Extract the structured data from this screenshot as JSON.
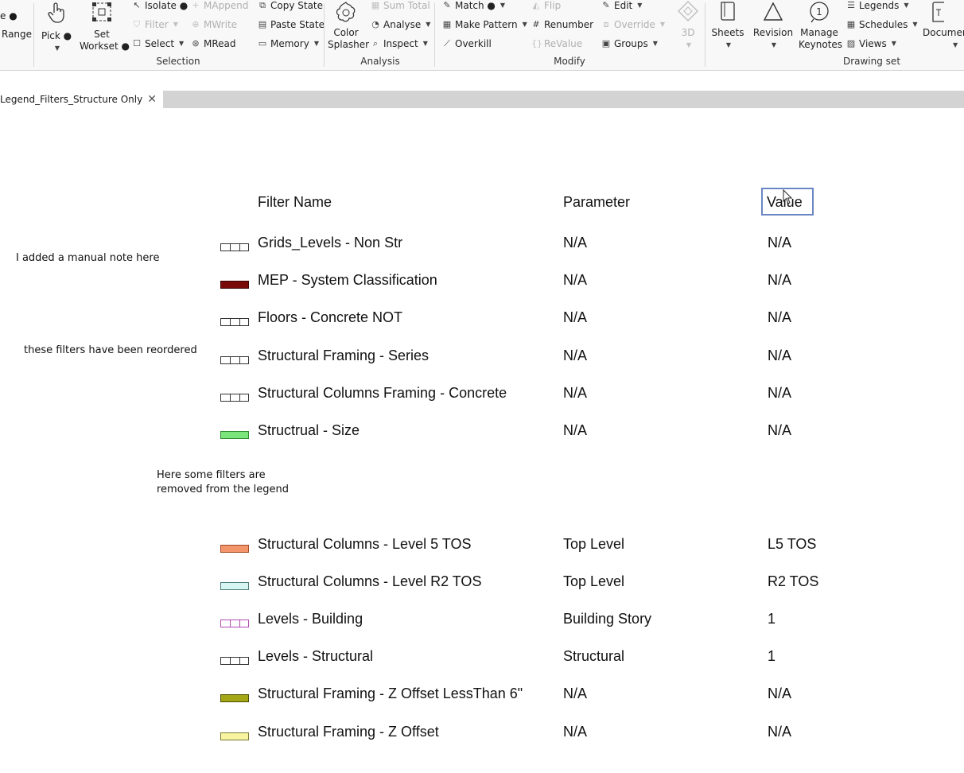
{
  "ribbon": {
    "left_cut": {
      "top": "e ●",
      "range": "Range"
    },
    "pick": {
      "label": "Pick ●"
    },
    "set_workset": {
      "line1": "Set",
      "line2": "Workset ●"
    },
    "selection_col1": {
      "isolate": "Isolate ●",
      "filter": "Filter",
      "select": "Select"
    },
    "selection_col2": {
      "mappend": "MAppend",
      "mwrite": "MWrite",
      "mread": "MRead"
    },
    "selection_col3": {
      "copy_state": "Copy State",
      "paste_state": "Paste State",
      "memory": "Memory"
    },
    "panel_selection": "Selection",
    "color_splasher": {
      "line1": "Color",
      "line2": "Splasher"
    },
    "analysis_col": {
      "sum_total": "Sum Total",
      "analyse": "Analyse",
      "inspect": "Inspect"
    },
    "panel_analysis": "Analysis",
    "modify_col1": {
      "match": "Match ●",
      "make_pattern": "Make Pattern",
      "overkill": "Overkill"
    },
    "modify_col2": {
      "flip": "Flip",
      "renumber": "Renumber",
      "revalue": "ReValue"
    },
    "modify_col3": {
      "edit": "Edit",
      "override": "Override",
      "groups": "Groups"
    },
    "panel_modify": "Modify",
    "threed": "3D",
    "sheets": "Sheets",
    "revision": "Revision",
    "manage_keynotes": {
      "line1": "Manage",
      "line2": "Keynotes"
    },
    "drawing_col": {
      "legends": "Legends",
      "schedules": "Schedules",
      "views": "Views"
    },
    "panel_drawing_set": "Drawing set",
    "documents": "Documen"
  },
  "tab": {
    "title": "Legend_Filters_Structure Only",
    "close": "✕"
  },
  "legend": {
    "headers": {
      "name": "Filter Name",
      "parameter": "Parameter",
      "value": "Value"
    },
    "rows_top": [
      {
        "name": "Grids_Levels - Non Str",
        "parameter": "N/A",
        "value": "N/A",
        "fill": "hatch",
        "border": "#333333"
      },
      {
        "name": "MEP - System Classification",
        "parameter": "N/A",
        "value": "N/A",
        "fill": "#7a0a0a",
        "border": "#3a0000"
      },
      {
        "name": "Floors - Concrete NOT",
        "parameter": "N/A",
        "value": "N/A",
        "fill": "hatch",
        "border": "#333333"
      },
      {
        "name": "Structural Framing - Series",
        "parameter": "N/A",
        "value": "N/A",
        "fill": "hatch",
        "border": "#333333"
      },
      {
        "name": "Structural Columns Framing - Concrete",
        "parameter": "N/A",
        "value": "N/A",
        "fill": "hatch",
        "border": "#333333"
      },
      {
        "name": "Structrual - Size",
        "parameter": "N/A",
        "value": "N/A",
        "fill": "#7be57b",
        "border": "#2f8a2f"
      }
    ],
    "rows_bottom": [
      {
        "name": "Structural Columns - Level 5 TOS",
        "parameter": "Top Level",
        "value": "L5 TOS",
        "fill": "#f4946a",
        "border": "#a04a24"
      },
      {
        "name": "Structural Columns - Level R2 TOS",
        "parameter": "Top Level",
        "value": "R2 TOS",
        "fill": "#d6f5f3",
        "border": "#4a7a78"
      },
      {
        "name": "Levels - Building",
        "parameter": "Building Story",
        "value": "1",
        "fill": "hatch",
        "border": "#b04ab0"
      },
      {
        "name": "Levels - Structural",
        "parameter": "Structural",
        "value": "1",
        "fill": "hatch",
        "border": "#333333"
      },
      {
        "name": "Structural Framing - Z Offset LessThan 6\"",
        "parameter": "N/A",
        "value": "N/A",
        "fill": "#a3a716",
        "border": "#4a4c00"
      },
      {
        "name": "Structural Framing - Z Offset",
        "parameter": "N/A",
        "value": "N/A",
        "fill": "#f7f5a0",
        "border": "#7a7830"
      }
    ]
  },
  "notes": {
    "manual": "I added a manual note here",
    "reordered": "these filters have been reordered",
    "removed_line1": "Here some filters are",
    "removed_line2": "removed from the legend"
  }
}
